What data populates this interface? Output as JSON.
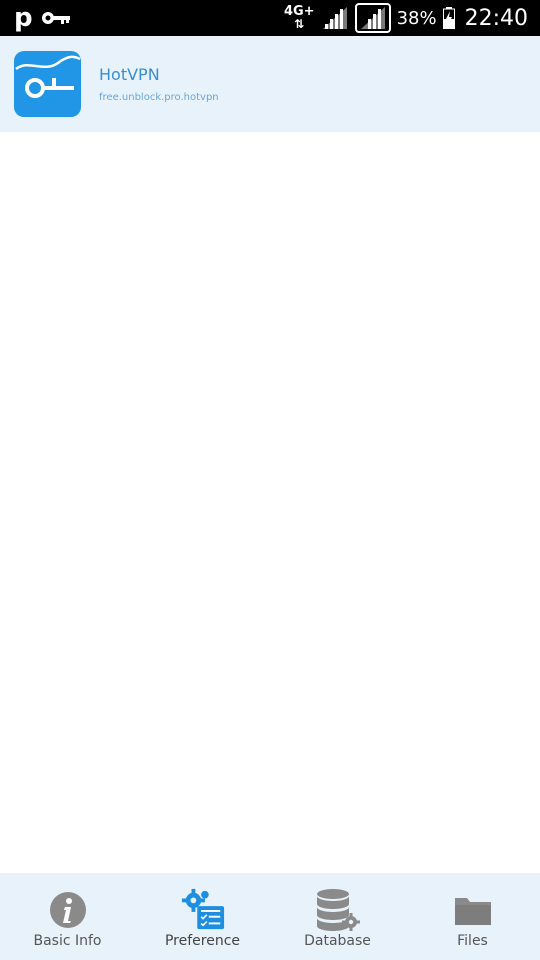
{
  "status_bar": {
    "network": "4G+",
    "battery_percent": "38%",
    "time": "22:40"
  },
  "app": {
    "name": "HotVPN",
    "package": "free.unblock.pro.hotvpn",
    "icon": "key-icon",
    "icon_color": "#2196e6"
  },
  "nav": {
    "items": [
      {
        "label": "Basic Info",
        "icon": "info-icon"
      },
      {
        "label": "Preference",
        "icon": "preference-gear-icon",
        "active": true
      },
      {
        "label": "Database",
        "icon": "database-icon"
      },
      {
        "label": "Files",
        "icon": "folder-icon"
      }
    ]
  },
  "colors": {
    "accent": "#2196e6",
    "header_bg": "#e8f2fb",
    "status_bar_bg": "#000000"
  }
}
